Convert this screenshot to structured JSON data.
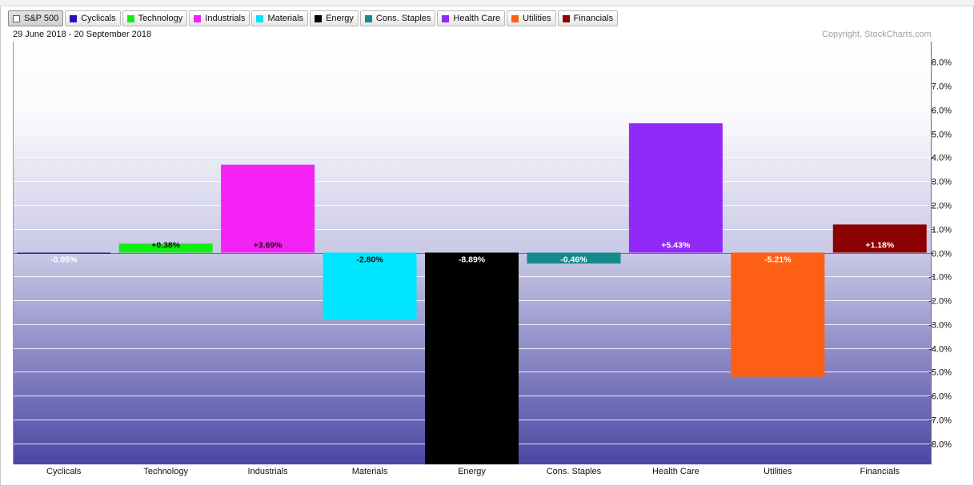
{
  "legend": {
    "items": [
      {
        "label": "S&P 500",
        "color": "#ffffff",
        "hollow": true,
        "active": true
      },
      {
        "label": "Cyclicals",
        "color": "#2a13b6"
      },
      {
        "label": "Technology",
        "color": "#11ee11"
      },
      {
        "label": "Industrials",
        "color": "#f522f5"
      },
      {
        "label": "Materials",
        "color": "#00e5ff"
      },
      {
        "label": "Energy",
        "color": "#000000"
      },
      {
        "label": "Cons. Staples",
        "color": "#158a8a"
      },
      {
        "label": "Health Care",
        "color": "#9129f9"
      },
      {
        "label": "Utilities",
        "color": "#ff5f14"
      },
      {
        "label": "Financials",
        "color": "#8b0000"
      }
    ]
  },
  "header": {
    "date_range": "29 June 2018 - 20 September 2018",
    "copyright": "Copyright, StockCharts.com"
  },
  "chart_data": {
    "type": "bar",
    "categories": [
      "Cyclicals",
      "Technology",
      "Industrials",
      "Materials",
      "Energy",
      "Cons. Staples",
      "Health Care",
      "Utilities",
      "Financials"
    ],
    "values": [
      -0.05,
      0.38,
      3.69,
      -2.8,
      -8.89,
      -0.46,
      5.43,
      -5.21,
      1.18
    ],
    "data_labels": [
      "-0.05%",
      "+0.38%",
      "+3.69%",
      "-2.80%",
      "-8.89%",
      "-0.46%",
      "+5.43%",
      "-5.21%",
      "+1.18%"
    ],
    "colors": [
      "#2a13b6",
      "#11ee11",
      "#f522f5",
      "#00e5ff",
      "#000000",
      "#158a8a",
      "#9129f9",
      "#ff5f14",
      "#8b0000"
    ],
    "label_colors": [
      "#ffffff",
      "#111111",
      "#111111",
      "#111111",
      "#ffffff",
      "#ffffff",
      "#ffffff",
      "#ffffff",
      "#ffffff"
    ],
    "y_ticks": [
      "8.0%",
      "7.0%",
      "6.0%",
      "5.0%",
      "4.0%",
      "3.0%",
      "2.0%",
      "1.0%",
      "0.0%",
      "-1.0%",
      "-2.0%",
      "-3.0%",
      "-4.0%",
      "-5.0%",
      "-6.0%",
      "-7.0%",
      "-8.0%"
    ],
    "y_tick_values": [
      8,
      7,
      6,
      5,
      4,
      3,
      2,
      1,
      0,
      -1,
      -2,
      -3,
      -4,
      -5,
      -6,
      -7,
      -8
    ],
    "ylim": [
      -8.89,
      8.2
    ],
    "grid": true,
    "y_axis_side": "right",
    "legend_position": "top"
  }
}
